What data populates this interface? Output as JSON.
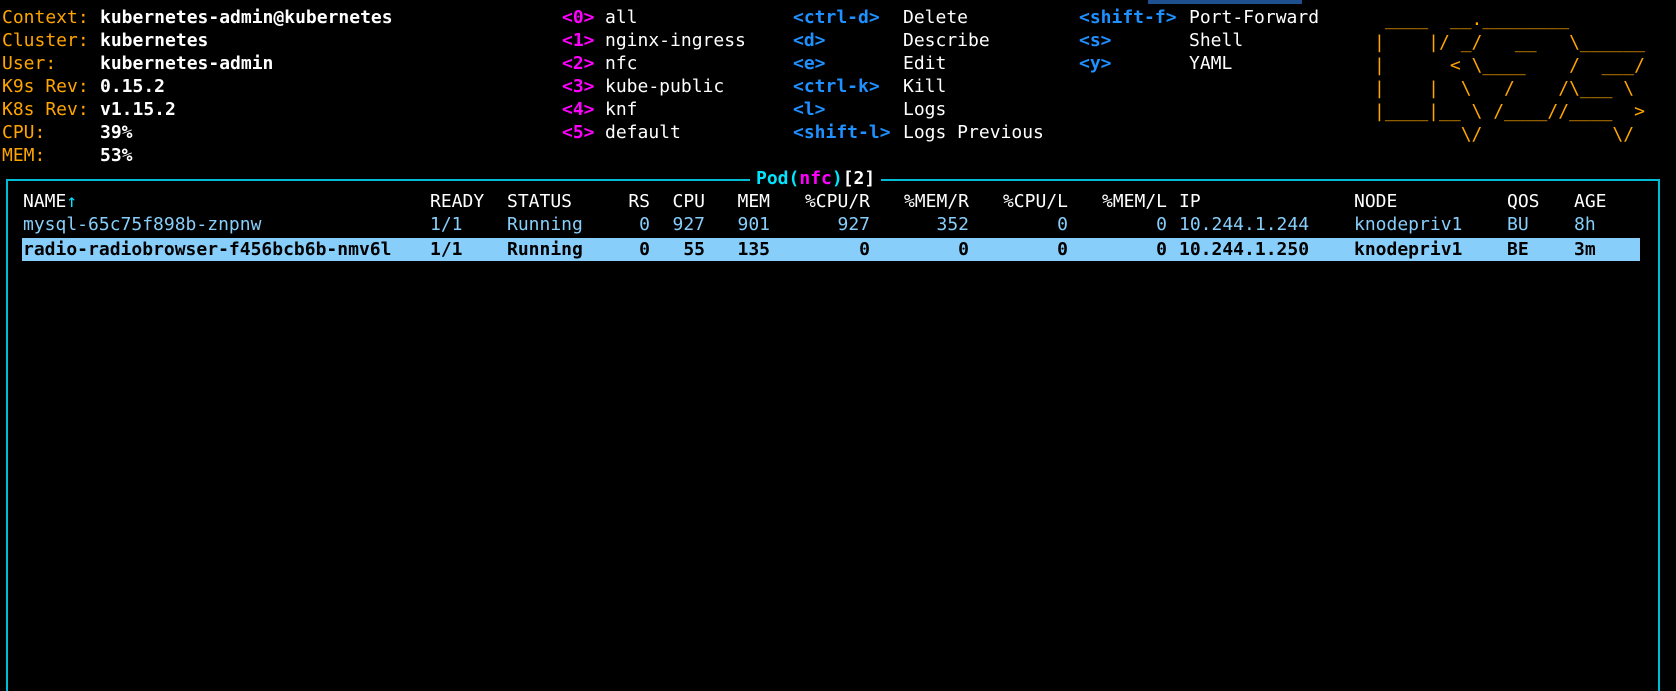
{
  "info": {
    "context_label": "Context:",
    "context_value": "kubernetes-admin@kubernetes",
    "cluster_label": "Cluster:",
    "cluster_value": "kubernetes",
    "user_label": "User:",
    "user_value": "kubernetes-admin",
    "k9s_label": "K9s Rev:",
    "k9s_value": "0.15.2",
    "k8s_label": "K8s Rev:",
    "k8s_value": "v1.15.2",
    "cpu_label": "CPU:",
    "cpu_value": "39%",
    "mem_label": "MEM:",
    "mem_value": "53%"
  },
  "namespaces": [
    {
      "key": "<0>",
      "name": "all"
    },
    {
      "key": "<1>",
      "name": "nginx-ingress"
    },
    {
      "key": "<2>",
      "name": "nfc"
    },
    {
      "key": "<3>",
      "name": "kube-public"
    },
    {
      "key": "<4>",
      "name": "knf"
    },
    {
      "key": "<5>",
      "name": "default"
    }
  ],
  "actions1": [
    {
      "key": "<ctrl-d>",
      "name": "Delete"
    },
    {
      "key": "<d>",
      "name": "Describe"
    },
    {
      "key": "<e>",
      "name": "Edit"
    },
    {
      "key": "<ctrl-k>",
      "name": "Kill"
    },
    {
      "key": "<l>",
      "name": "Logs"
    },
    {
      "key": "<shift-l>",
      "name": "Logs Previous"
    }
  ],
  "actions2": [
    {
      "key": "<shift-f>",
      "name": "Port-Forward"
    },
    {
      "key": "<s>",
      "name": "Shell"
    },
    {
      "key": "<y>",
      "name": "YAML"
    }
  ],
  "logo": " ____  __.________\n|    |/ _/   __   \\______\n|      < \\____    /  ___/\n|    |  \\   /    /\\___ \\\n|____|__ \\ /____//____  >\n        \\/            \\/",
  "table": {
    "title_resource": "Pod",
    "title_open": "(",
    "title_ns": "nfc",
    "title_close": ")",
    "title_count": "[2]",
    "sort_arrow": "↑",
    "headers": {
      "name": "NAME",
      "ready": "READY",
      "status": "STATUS",
      "rs": "RS",
      "cpu": "CPU",
      "mem": "MEM",
      "cpur": "%CPU/R",
      "memr": "%MEM/R",
      "cpul": "%CPU/L",
      "meml": "%MEM/L",
      "ip": "IP",
      "node": "NODE",
      "qos": "QOS",
      "age": "AGE"
    },
    "rows": [
      {
        "name": "mysql-65c75f898b-znpnw",
        "ready": "1/1",
        "status": "Running",
        "rs": "0",
        "cpu": "927",
        "mem": "901",
        "cpur": "927",
        "memr": "352",
        "cpul": "0",
        "meml": "0",
        "ip": "10.244.1.244",
        "node": "knodepriv1",
        "qos": "BU",
        "age": "8h"
      },
      {
        "name": "radio-radiobrowser-f456bcb6b-nmv6l",
        "ready": "1/1",
        "status": "Running",
        "rs": "0",
        "cpu": "55",
        "mem": "135",
        "cpur": "0",
        "memr": "0",
        "cpul": "0",
        "meml": "0",
        "ip": "10.244.1.250",
        "node": "knodepriv1",
        "qos": "BE",
        "age": "3m"
      }
    ]
  }
}
